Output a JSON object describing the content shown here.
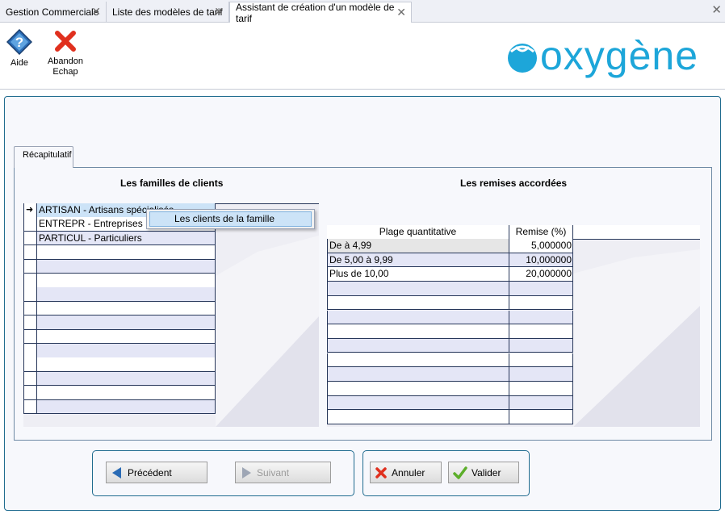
{
  "tabs": [
    {
      "label": "Gestion Commerciale",
      "active": false
    },
    {
      "label": "Liste des modèles de tarif",
      "active": false
    },
    {
      "label": "Assistant de création d'un modèle de tarif",
      "active": true
    }
  ],
  "window_close": "✕",
  "tab_close": "✕",
  "toolbar": {
    "help_label": "Aide",
    "abort_label": "Abandon",
    "abort_shortcut": "Echap"
  },
  "logo_text": "oxygène",
  "recap_tab_label": "Récapitulatif",
  "families": {
    "title": "Les familles de clients",
    "current_marker": "➜",
    "rows": [
      "ARTISAN - Artisans spécialisés",
      "ENTREPR - Entreprises",
      "PARTICUL - Particuliers"
    ],
    "empty_rows": 12
  },
  "context_menu": {
    "items": [
      "Les clients de la famille"
    ]
  },
  "discounts": {
    "title": "Les remises accordées",
    "headers": [
      "Plage quantitative",
      "Remise (%)"
    ],
    "rows": [
      {
        "range": "De  à 4,99",
        "discount": "5,000000"
      },
      {
        "range": "De 5,00 à 9,99",
        "discount": "10,000000"
      },
      {
        "range": "Plus de 10,00",
        "discount": "20,000000"
      }
    ],
    "empty_rows": 10
  },
  "buttons": {
    "previous": "Précédent",
    "next": "Suivant",
    "cancel": "Annuler",
    "validate": "Valider"
  },
  "colors": {
    "accent": "#1f6b8f",
    "selection": "#cce3f7",
    "grid_line": "#27375a",
    "logo": "#1da6d9"
  }
}
